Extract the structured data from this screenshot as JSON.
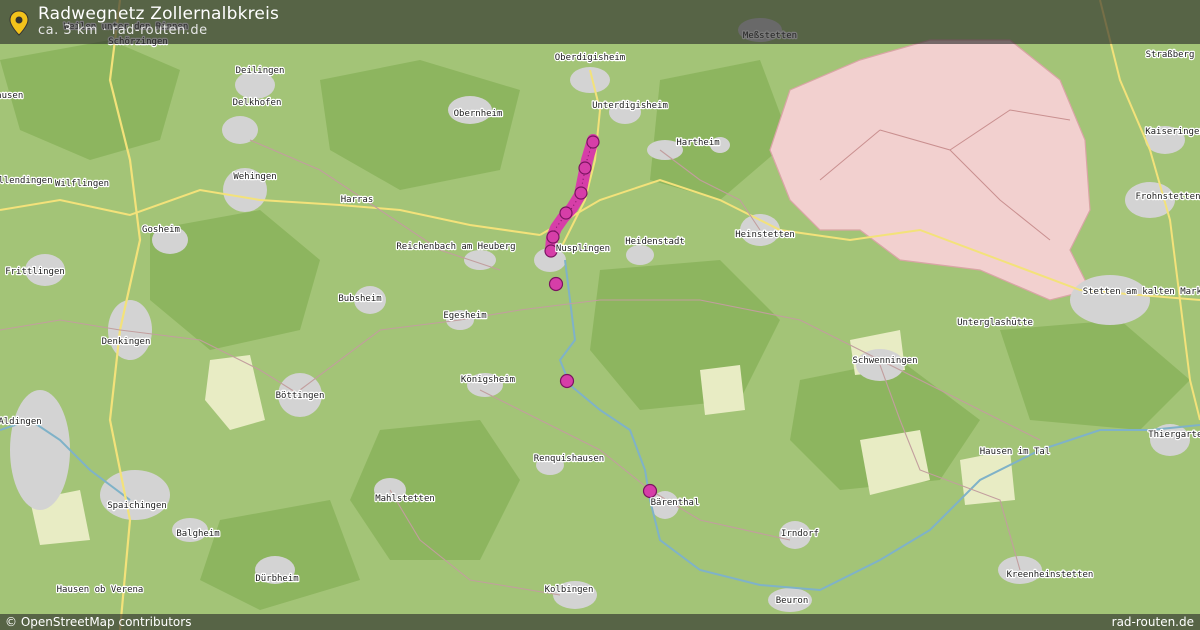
{
  "header": {
    "title": "Radwegnetz Zollernalbkreis",
    "subtitle": "ca. 3 km · rad-routen.de"
  },
  "footer": {
    "attribution": "© OpenStreetMap contributors",
    "brand": "rad-routen.de"
  },
  "map": {
    "route_color": "#d63ea8",
    "places": [
      "Schörzingen",
      "Deilingen",
      "Delkhofen",
      "Wilflingen",
      "Wellendingen",
      "Wehingen",
      "Gosheim",
      "Frittlingen",
      "Denkingen",
      "Böttingen",
      "Aldingen",
      "Spaichingen",
      "Balgheim",
      "Dürbheim",
      "Hausen ob Verena",
      "Harras",
      "Obernheim",
      "Reichenbach am Heuberg",
      "Bubsheim",
      "Egesheim",
      "Königsheim",
      "Renquishausen",
      "Mahlstetten",
      "Kolbingen",
      "Oberdigisheim",
      "Unterdigisheim",
      "Meßstetten",
      "Hartheim",
      "Heidenstadt",
      "Nusplingen",
      "Heinstetten",
      "Unterglashütte",
      "Schwenningen",
      "Bärenthal",
      "Irndorf",
      "Beuron",
      "Hausen im Tal",
      "Kreenheinstetten",
      "Straßberg",
      "Kaiseringen",
      "Frohnstetten",
      "Stetten am kalten Markt",
      "Thiergarten",
      "Hausen",
      "Weilen unter den Rinnen"
    ]
  }
}
